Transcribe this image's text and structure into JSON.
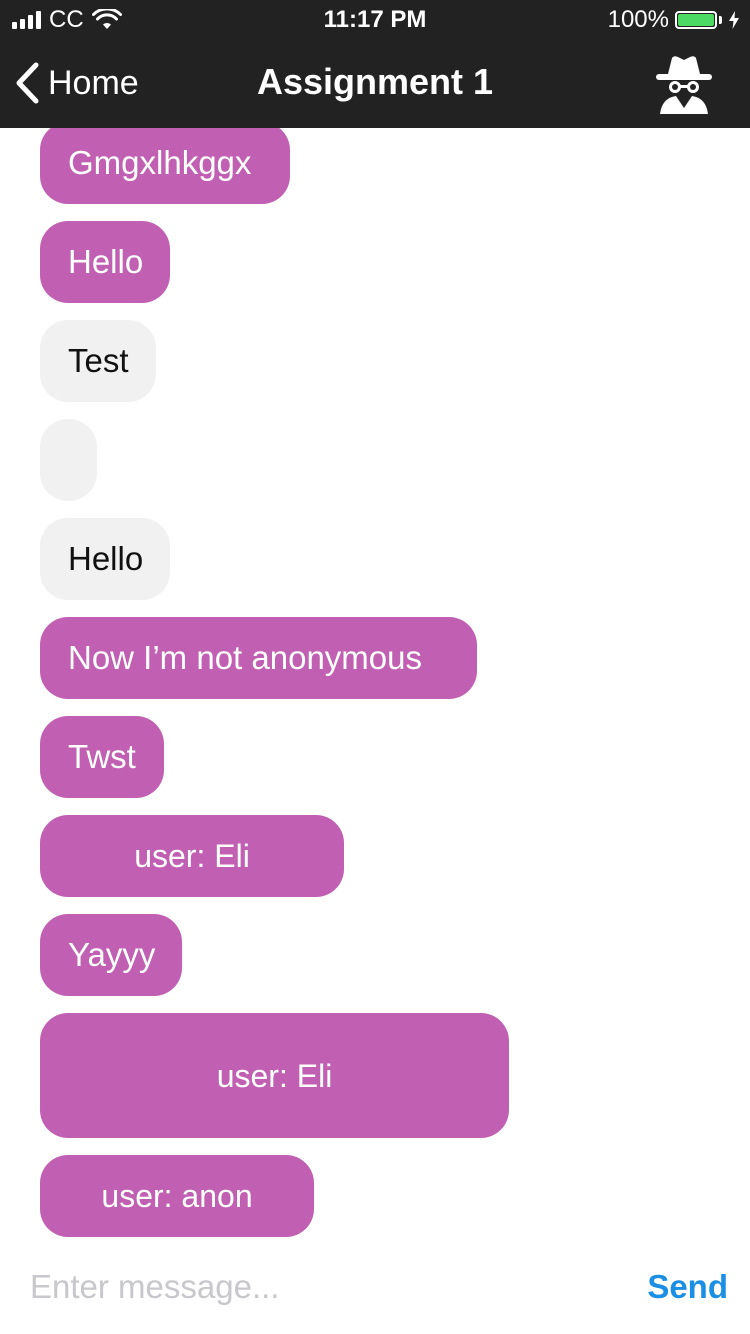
{
  "status_bar": {
    "carrier": "CC",
    "time": "11:17 PM",
    "battery_percent": "100%",
    "battery_level": 1.0,
    "icons": [
      "signal-icon",
      "wifi-icon",
      "battery-icon",
      "charging-bolt-icon"
    ]
  },
  "nav": {
    "back_label": "Home",
    "title": "Assignment 1",
    "right_icon": "incognito-spy-icon"
  },
  "colors": {
    "bar_background": "#222222",
    "mine_bubble": "#c160b2",
    "other_bubble": "#f1f1f1",
    "send_blue": "#1a8fe3",
    "battery_green": "#4cd964"
  },
  "messages": [
    {
      "text": "Gmgxlhkggx",
      "sender": "mine"
    },
    {
      "text": "Hello",
      "sender": "mine"
    },
    {
      "text": "Test",
      "sender": "other"
    },
    {
      "text": "",
      "sender": "other"
    },
    {
      "text": "Hello",
      "sender": "other"
    },
    {
      "text": "Now I’m not anonymous",
      "sender": "mine"
    },
    {
      "text": "Twst",
      "sender": "mine"
    },
    {
      "text": "user: Eli",
      "sender": "mine"
    },
    {
      "text": "Yayyy",
      "sender": "mine"
    },
    {
      "text": "user: Eli",
      "sender": "mine"
    },
    {
      "text": "user: anon",
      "sender": "mine"
    }
  ],
  "composer": {
    "placeholder": "Enter message...",
    "value": "",
    "send_label": "Send"
  }
}
